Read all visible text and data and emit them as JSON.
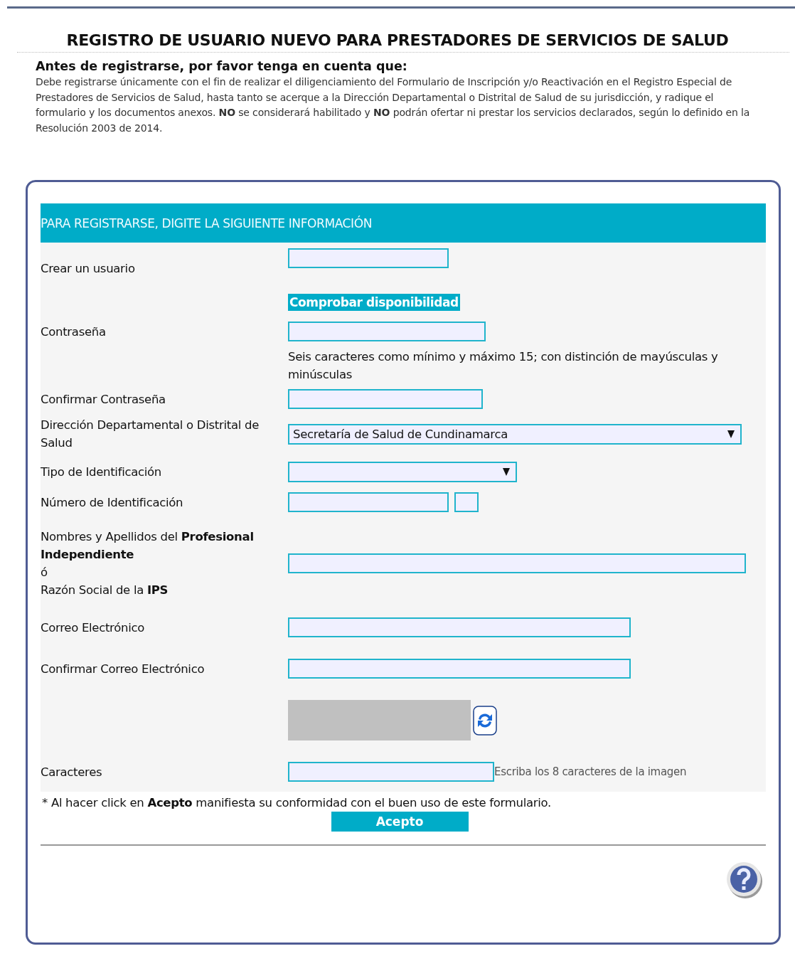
{
  "title": "REGISTRO DE USUARIO NUEVO PARA PRESTADORES DE SERVICIOS DE SALUD",
  "notice": {
    "heading": "Antes de registrarse, por favor tenga en cuenta que:",
    "body": "Debe registrarse únicamente con el fin de realizar el diligenciamiento del Formulario de Inscripción y/o Reactivación en el Registro Especial de Prestadores de Servicios de Salud, hasta tanto se acerque a la Dirección Departamental o Distrital de Salud de su jurisdicción, y radique el formulario y los documentos anexos. **NO** se considerará habilitado y **NO** podrán ofertar ni prestar los servicios declarados, según lo definido en la Resolución 2003 de 2014."
  },
  "form": {
    "header": "PARA REGISTRARSE, DIGITE LA SIGUIENTE INFORMACIÓN",
    "rows": [
      {
        "kind": "input",
        "label": "Crear un usuario"
      },
      {
        "kind": "button",
        "label": "Comprobar disponibilidad"
      },
      {
        "kind": "input",
        "label": "Contraseña"
      },
      {
        "kind": "hint",
        "text": "Seis caracteres como mínimo y máximo 15; con distinción de mayúsculas y minúsculas"
      },
      {
        "kind": "input",
        "label": "Confirmar Contraseña"
      },
      {
        "kind": "select",
        "label": "Dirección Departamental o Distrital de Salud",
        "value": "Secretaría de Salud de Cundinamarca"
      },
      {
        "kind": "select",
        "label": "Tipo de Identificación"
      },
      {
        "kind": "id",
        "label": "Número de Identificación"
      },
      {
        "kind": "input",
        "label": [
          "Nombres y Apellidos del **Profesional Independiente**",
          "ó",
          "Razón Social de la **IPS**"
        ]
      },
      {
        "kind": "input",
        "label": "Correo Electrónico"
      },
      {
        "kind": "input",
        "label": "Confirmar Correo Electrónico"
      },
      {
        "kind": "captcha"
      },
      {
        "kind": "input",
        "label": "Caracteres",
        "hint": "Escriba los 8 caracteres de la imagen"
      }
    ],
    "note": "* Al hacer click en **Acepto** manifiesta su conformidad con el buen uso de este formulario.",
    "submit": "Acepto"
  }
}
